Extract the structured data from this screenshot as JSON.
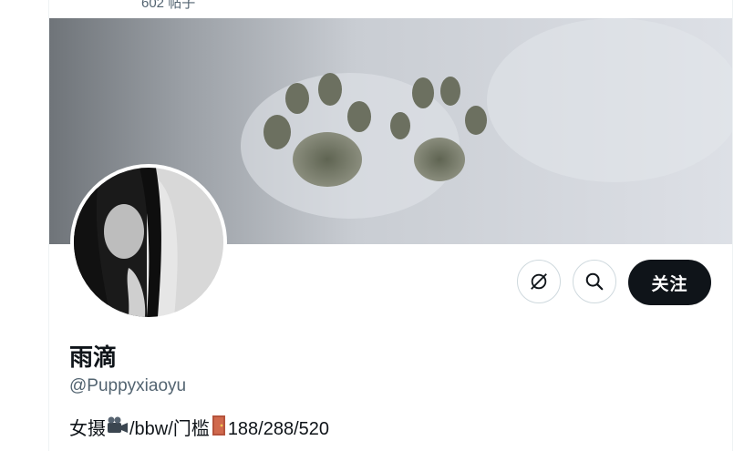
{
  "header": {
    "post_count": "602 帖子"
  },
  "profile": {
    "display_name": "雨滴",
    "handle": "@Puppyxiaoyu",
    "bio": {
      "part1": "女摄",
      "part1_emoji": "video-camera-icon",
      "part2": "/bbw/门槛",
      "part2_emoji": "door-icon",
      "part3": "188/288/520"
    }
  },
  "actions": {
    "grok_icon": "grok-icon",
    "search_icon": "search-icon",
    "follow_label": "关注"
  },
  "colors": {
    "follow_bg": "#0f1419",
    "handle": "#536471",
    "border": "#cfd9de"
  }
}
